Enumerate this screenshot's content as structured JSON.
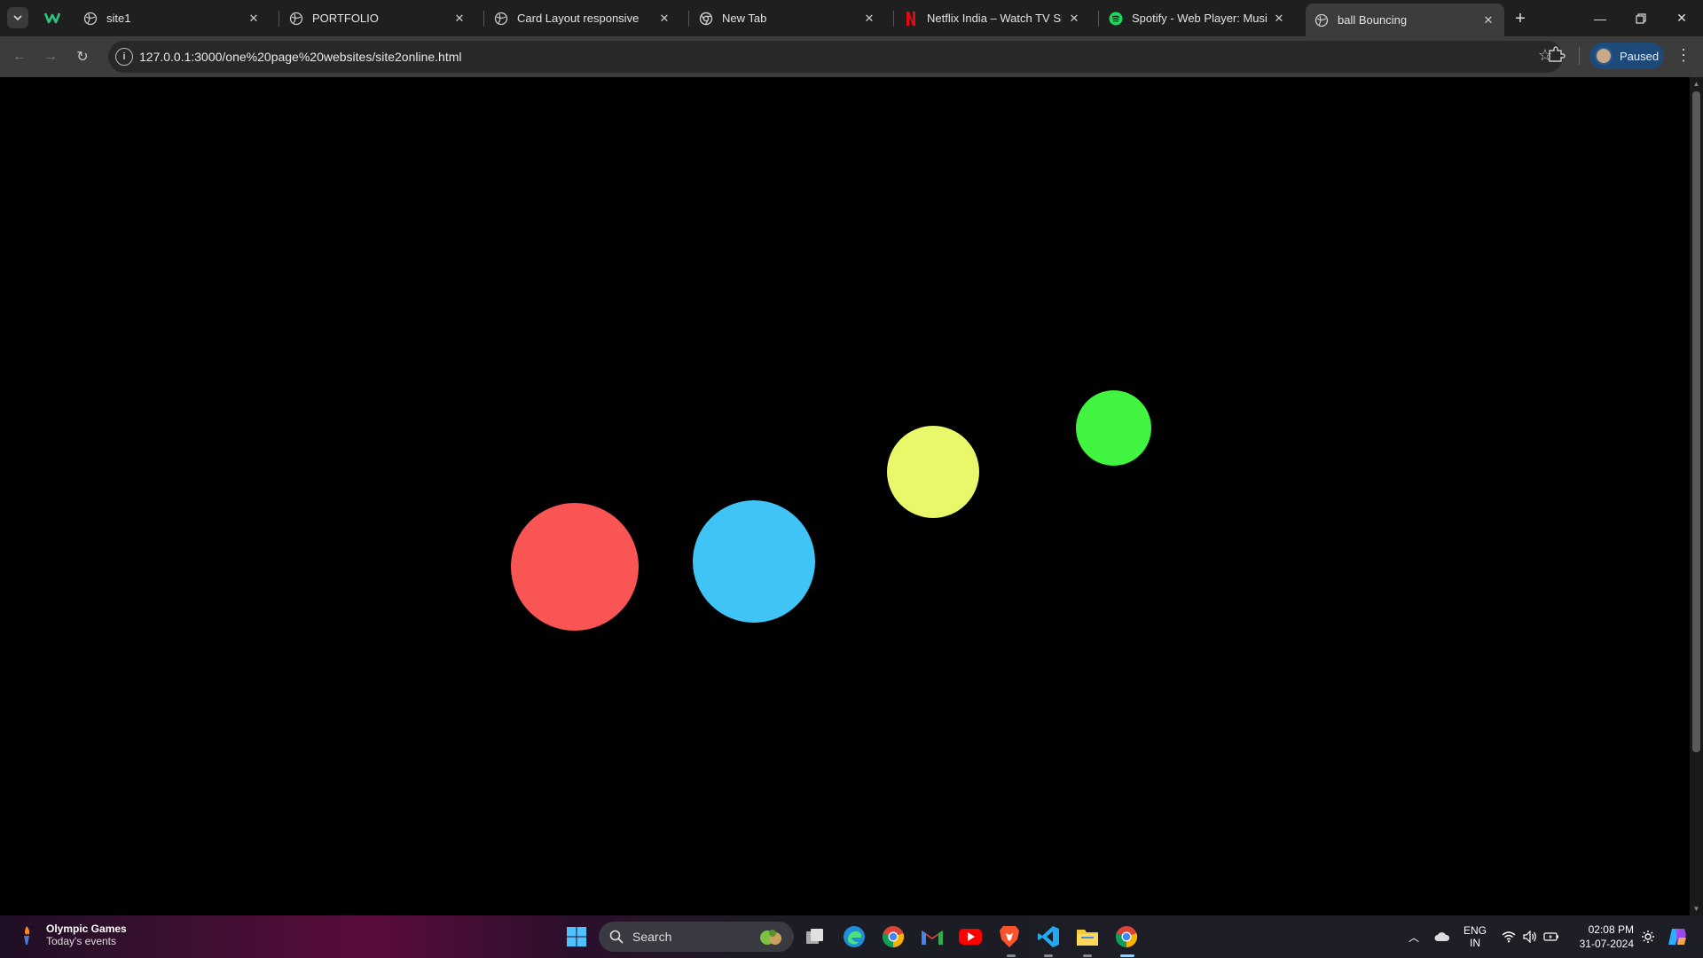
{
  "browser": {
    "tabs": [
      {
        "title": "site1",
        "favicon": "globe-icon",
        "active": false
      },
      {
        "title": "PORTFOLIO",
        "favicon": "globe-icon",
        "active": false
      },
      {
        "title": "Card Layout responsive",
        "favicon": "globe-icon",
        "active": false
      },
      {
        "title": "New Tab",
        "favicon": "chrome-icon",
        "active": false
      },
      {
        "title": "Netflix India – Watch TV Shows",
        "favicon": "netflix-icon",
        "active": false
      },
      {
        "title": "Spotify - Web Player: Music fo",
        "favicon": "spotify-icon",
        "active": false
      },
      {
        "title": "ball Bouncing",
        "favicon": "globe-icon",
        "active": true
      }
    ],
    "pinned_tab_icon": "webflow-icon",
    "url": "127.0.0.1:3000/one%20page%20websites/site2online.html",
    "profile_status": "Paused"
  },
  "page": {
    "background": "#000000",
    "balls": [
      {
        "name": "red-ball",
        "color": "#f95555"
      },
      {
        "name": "blue-ball",
        "color": "#40c4f6"
      },
      {
        "name": "yellow-ball",
        "color": "#e8f86a"
      },
      {
        "name": "green-ball",
        "color": "#40f440"
      }
    ]
  },
  "taskbar": {
    "widget_title": "Olympic Games",
    "widget_subtitle": "Today's events",
    "search_placeholder": "Search",
    "language_line1": "ENG",
    "language_line2": "IN",
    "time": "02:08 PM",
    "date": "31-07-2024"
  }
}
